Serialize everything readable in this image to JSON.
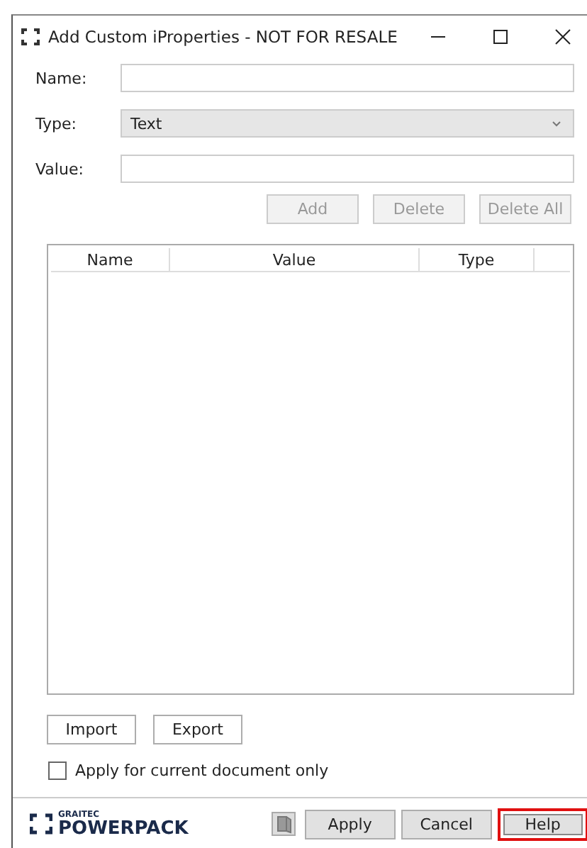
{
  "window": {
    "title": "Add Custom iProperties - NOT FOR RESALE"
  },
  "fields": [
    {
      "label": "Name:",
      "kind": "input"
    },
    {
      "label": "Type:",
      "kind": "select",
      "value": "Text"
    },
    {
      "label": "Value:",
      "kind": "input"
    }
  ],
  "row_buttons": [
    {
      "label": "Add",
      "disabled": true
    },
    {
      "label": "Delete",
      "disabled": true
    },
    {
      "label": "Delete All",
      "disabled": true
    }
  ],
  "table": {
    "columns": [
      "Name",
      "Value",
      "Type"
    ]
  },
  "io_buttons": [
    {
      "label": "Import",
      "disabled": false
    },
    {
      "label": "Export",
      "disabled": false
    }
  ],
  "checkbox": {
    "label": "Apply for current document only",
    "checked": false
  },
  "logo": {
    "brand": "GRAITEC",
    "product": "POWERPACK"
  },
  "footer_buttons": [
    {
      "label": "Apply",
      "highlighted": false
    },
    {
      "label": "Cancel",
      "highlighted": false
    },
    {
      "label": "Help",
      "highlighted": true
    }
  ]
}
